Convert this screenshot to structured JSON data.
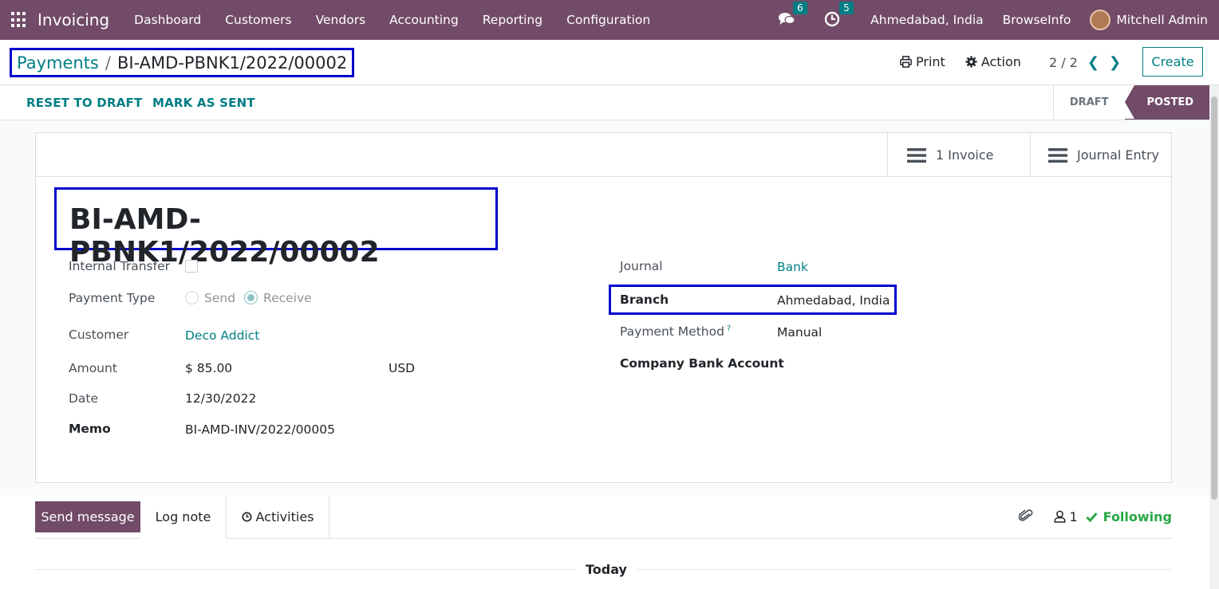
{
  "navbar": {
    "app_name": "Invoicing",
    "menu": [
      "Dashboard",
      "Customers",
      "Vendors",
      "Accounting",
      "Reporting",
      "Configuration"
    ],
    "messages_count": "6",
    "activities_count": "5",
    "branch": "Ahmedabad, India",
    "company": "BrowseInfo",
    "user": "Mitchell Admin"
  },
  "breadcrumb": {
    "parent": "Payments",
    "separator": "/",
    "current": "BI-AMD-PBNK1/2022/00002"
  },
  "control": {
    "print": "Print",
    "action": "Action",
    "pager": "2 / 2",
    "create": "Create"
  },
  "statusbar": {
    "reset_to_draft": "RESET TO DRAFT",
    "mark_as_sent": "MARK AS SENT",
    "stages": [
      "DRAFT",
      "POSTED"
    ],
    "active_stage": "POSTED"
  },
  "smart_buttons": {
    "invoice": "1 Invoice",
    "journal_entry": "Journal Entry"
  },
  "form": {
    "title": "BI-AMD-PBNK1/2022/00002",
    "internal_transfer_label": "Internal Transfer",
    "internal_transfer": false,
    "payment_type_label": "Payment Type",
    "payment_type_options": [
      "Send",
      "Receive"
    ],
    "payment_type_selected": "Receive",
    "customer_label": "Customer",
    "customer": "Deco Addict",
    "amount_label": "Amount",
    "amount": "$ 85.00",
    "currency": "USD",
    "date_label": "Date",
    "date": "12/30/2022",
    "memo_label": "Memo",
    "memo": "BI-AMD-INV/2022/00005",
    "journal_label": "Journal",
    "journal": "Bank",
    "branch_label": "Branch",
    "branch": "Ahmedabad, India",
    "payment_method_label": "Payment Method",
    "payment_method_help": "?",
    "payment_method": "Manual",
    "company_bank_account_label": "Company Bank Account",
    "company_bank_account": ""
  },
  "chatter": {
    "send_message": "Send message",
    "log_note": "Log note",
    "activities": "Activities",
    "followers_count": "1",
    "following": "Following",
    "today": "Today"
  },
  "colors": {
    "brand": "#714b67",
    "link": "#017e84",
    "highlight_box": "#0000cc",
    "following": "#28a745"
  }
}
